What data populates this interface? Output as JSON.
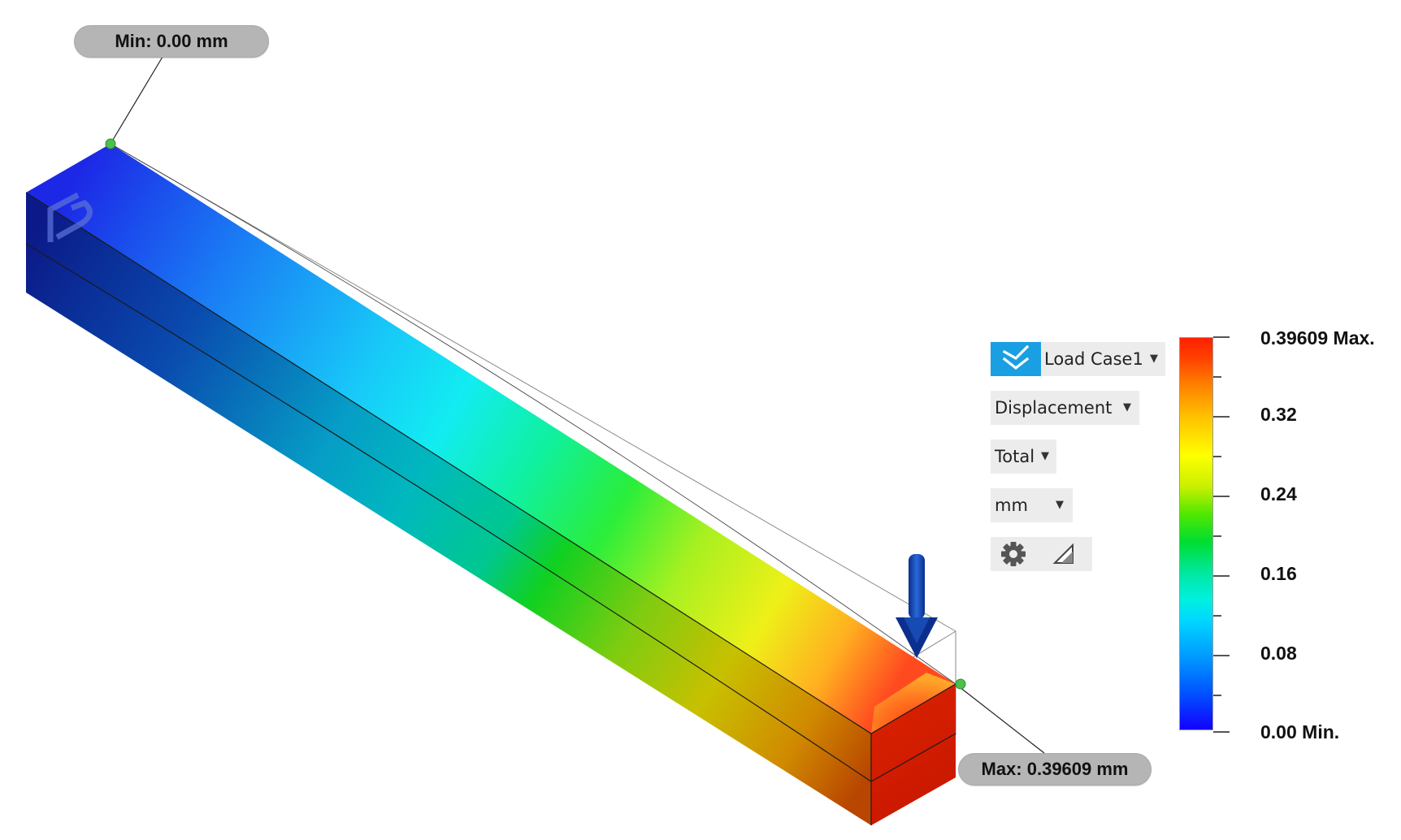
{
  "probes": {
    "min_label": "Min: 0.00 mm",
    "max_label": "Max: 0.39609 mm"
  },
  "controls": {
    "load_case": "Load Case1",
    "result_type": "Displacement",
    "component": "Total",
    "units": "mm"
  },
  "icons": {
    "load_case": "double-chevron-down-icon",
    "settings": "gear-icon",
    "contour": "contour-triangle-icon",
    "load": "load-arrow-icon",
    "watermark": "watermark-logo-icon"
  },
  "legend": {
    "labels": [
      "0.39609 Max.",
      "0.32",
      "0.24",
      "0.16",
      "0.08",
      "0.00 Min."
    ]
  },
  "colors": {
    "accent": "#1a9fe3",
    "load_arrow": "#1a4fb0",
    "probe_point": "#4cbf4c",
    "min_color": "#1400ff",
    "max_color": "#ff2000"
  }
}
